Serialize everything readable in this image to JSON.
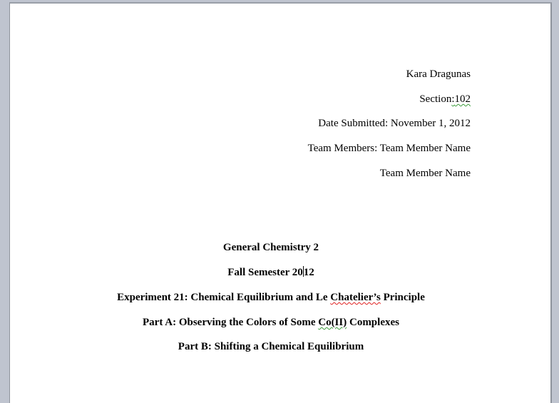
{
  "header": {
    "name": "Kara Dragunas",
    "section_label": "Section",
    "section_sep": ":",
    "section_value": "102",
    "date": "Date Submitted: November 1, 2012",
    "team_members": "Team Members: Team Member Name",
    "team_member_2": "Team Member Name"
  },
  "title_block": {
    "course": "General Chemistry 2",
    "semester_a": "Fall Semester 20",
    "semester_b": "12",
    "experiment_a": "Experiment 21: Chemical Equilibrium and Le ",
    "experiment_b": "Chatelier’s",
    "experiment_c": " Principle",
    "part_a_a": "Part A: Observing the Colors of Some ",
    "part_a_b": "Co(II)",
    "part_a_c": " Complexes",
    "part_b": "Part B: Shifting a Chemical Equilibrium"
  }
}
